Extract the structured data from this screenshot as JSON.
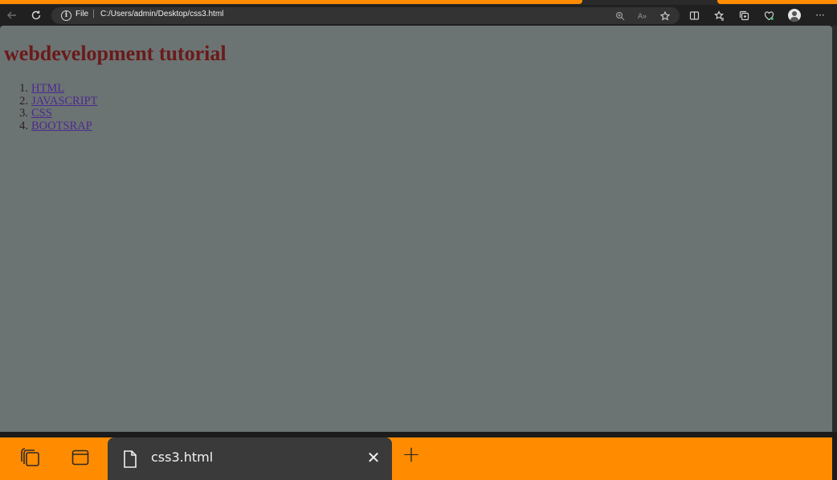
{
  "browser": {
    "protocol_label": "File",
    "separator": "|",
    "url": "C:/Users/admin/Desktop/css3.html",
    "read_aloud_label": "A»",
    "more_label": "···"
  },
  "page": {
    "title": "webdevelopment tutorial",
    "list": [
      {
        "num": "1.",
        "label": "HTML"
      },
      {
        "num": "2.",
        "label": "JAVASCRIPT"
      },
      {
        "num": "3.",
        "label": "CSS"
      },
      {
        "num": "4.",
        "label": "BOOTSRAP"
      }
    ]
  },
  "taskbar": {
    "tab_title": "css3.html",
    "close_label": "✕",
    "new_tab_label": "+"
  },
  "colors": {
    "accent": "#ff8c00",
    "page_background": "#6c7373",
    "title_color": "#6a1a1a",
    "link_color": "#4b2a8e"
  }
}
